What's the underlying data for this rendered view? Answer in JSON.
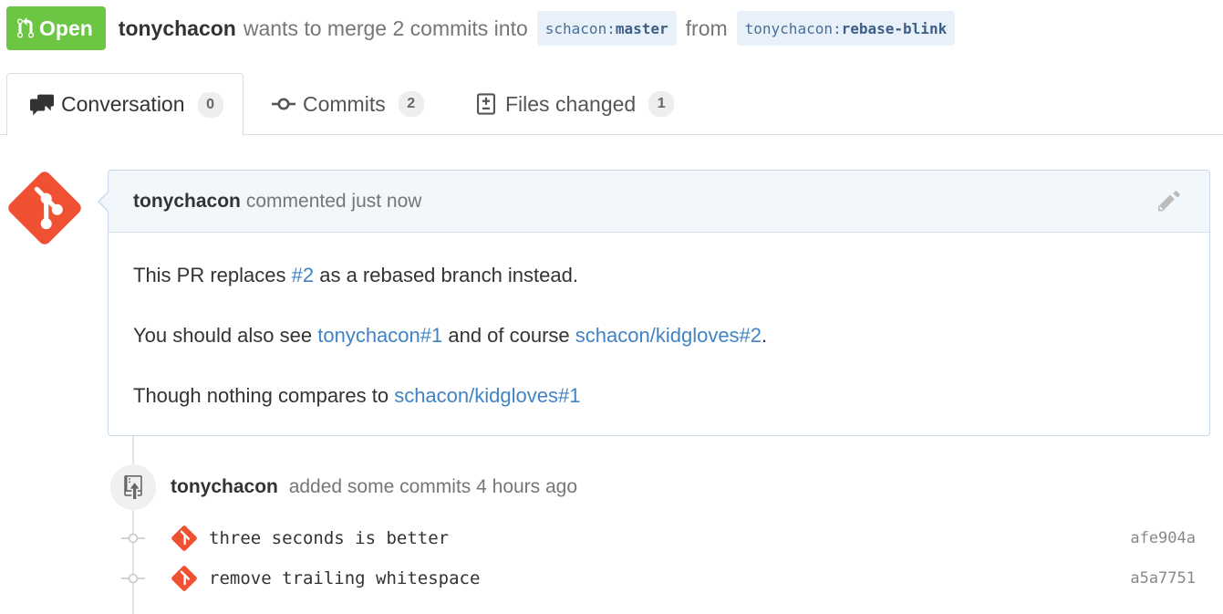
{
  "header": {
    "state_label": "Open",
    "author": "tonychacon",
    "merge_text": "wants to merge 2 commits into",
    "base_branch_owner": "schacon",
    "base_branch_name": "master",
    "from_text": "from",
    "head_branch_owner": "tonychacon",
    "head_branch_name": "rebase-blink",
    "state_color": "#6cc644"
  },
  "tabs": [
    {
      "label": "Conversation",
      "count": "0",
      "icon": "comment-discussion-icon"
    },
    {
      "label": "Commits",
      "count": "2",
      "icon": "git-commit-icon"
    },
    {
      "label": "Files changed",
      "count": "1",
      "icon": "diff-icon"
    }
  ],
  "comment": {
    "author": "tonychacon",
    "action": "commented just now",
    "line1_pre": "This PR replaces ",
    "line1_link": "#2",
    "line1_post": " as a rebased branch instead.",
    "line2_pre": "You should also see ",
    "line2_link1": "tonychacon#1",
    "line2_mid": " and of course ",
    "line2_link2": "schacon/kidgloves#2",
    "line2_post": ".",
    "line3_pre": "Though nothing compares to ",
    "line3_link": "schacon/kidgloves#1",
    "link_color": "#4183c4"
  },
  "event": {
    "author": "tonychacon",
    "text": "added some commits 4 hours ago"
  },
  "commits": [
    {
      "message": "three seconds is better",
      "sha": "afe904a"
    },
    {
      "message": "remove trailing whitespace",
      "sha": "a5a7751"
    }
  ],
  "git_logo_color": "#f05133"
}
